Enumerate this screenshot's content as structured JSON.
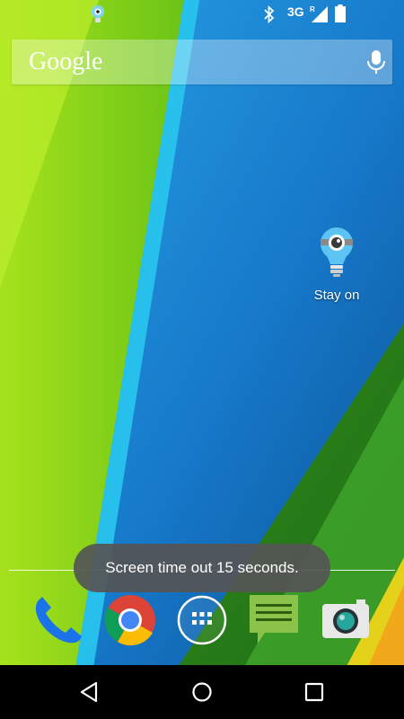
{
  "status_bar": {
    "network_type": "3G",
    "roaming_indicator": "R",
    "icons": [
      "stay-on-notification-icon",
      "bluetooth-icon",
      "signal-icon",
      "battery-icon"
    ]
  },
  "search_widget": {
    "logo_text": "Google",
    "mic_icon": "microphone-icon"
  },
  "home_shortcuts": [
    {
      "label": "Stay on",
      "icon": "lightbulb-eye-icon"
    }
  ],
  "toast": {
    "message": "Screen time out 15 seconds."
  },
  "dock": [
    {
      "app": "phone",
      "icon": "phone-icon"
    },
    {
      "app": "chrome",
      "icon": "chrome-icon"
    },
    {
      "app": "app-drawer",
      "icon": "app-drawer-icon"
    },
    {
      "app": "messaging",
      "icon": "messaging-icon"
    },
    {
      "app": "camera",
      "icon": "camera-icon"
    }
  ],
  "nav_bar": {
    "buttons": [
      "back-icon",
      "home-icon",
      "recents-icon"
    ]
  },
  "colors": {
    "wallpaper_blue": "#1a7fd0",
    "wallpaper_green": "#8fd81a",
    "nav_bar": "#000000",
    "toast_bg": "#555555"
  }
}
